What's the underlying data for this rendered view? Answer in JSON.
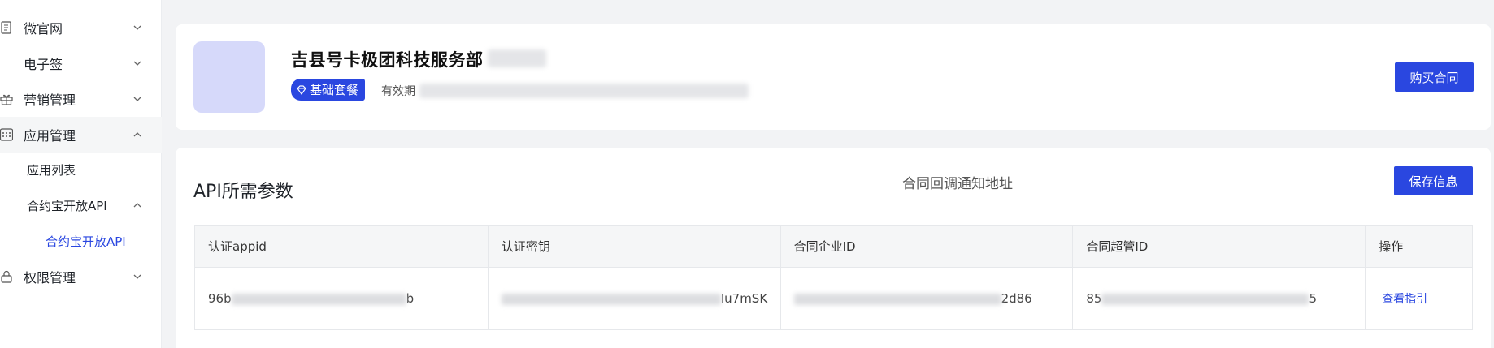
{
  "sidebar": {
    "items": [
      {
        "label": "微官网",
        "icon": "document-icon",
        "expanded": false
      },
      {
        "label": "电子签",
        "icon": "",
        "expanded": false
      },
      {
        "label": "营销管理",
        "icon": "gift-icon",
        "expanded": false
      },
      {
        "label": "应用管理",
        "icon": "grid-icon",
        "expanded": true
      },
      {
        "label": "权限管理",
        "icon": "lock-icon",
        "expanded": false
      }
    ],
    "sub_items": {
      "app_list": "应用列表",
      "contract_api_group": "合约宝开放API",
      "contract_api": "合约宝开放API"
    }
  },
  "company": {
    "name": "吉县号卡极团科技服务部",
    "package_badge": "基础套餐",
    "validity_label": "有效期"
  },
  "actions": {
    "buy_contract": "购买合同",
    "save_info": "保存信息"
  },
  "section": {
    "title": "API所需参数",
    "callback_label": "合同回调通知地址"
  },
  "table": {
    "headers": [
      "认证appid",
      "认证密钥",
      "合同企业ID",
      "合同超管ID",
      "操作"
    ],
    "rows": [
      {
        "appid_start": "96b",
        "appid_end": "b",
        "secret_end": "Iu7mSK",
        "corp_end": "2d86",
        "admin_start": "85",
        "admin_end": "5",
        "action": "查看指引"
      }
    ]
  },
  "colors": {
    "accent": "#2a47e0",
    "logo_bg": "#d6d9fa"
  }
}
